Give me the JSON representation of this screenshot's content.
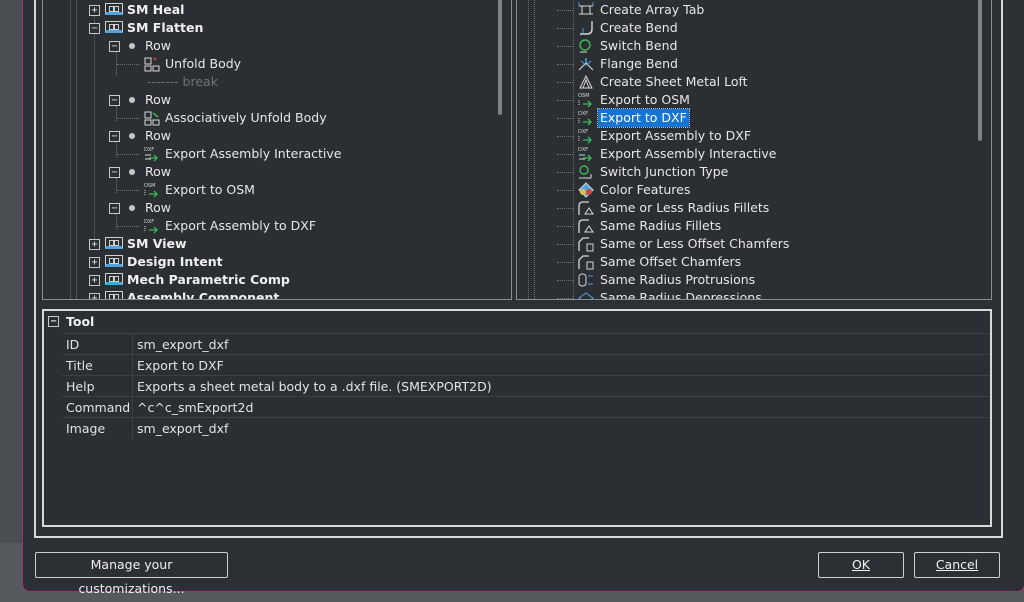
{
  "left_tree": [
    {
      "label": "SM Heal",
      "kind": "group",
      "expander": "+"
    },
    {
      "label": "SM Flatten",
      "kind": "group",
      "expander": "−"
    },
    {
      "label": "Row",
      "kind": "row",
      "expander": "−"
    },
    {
      "label": "Unfold Body",
      "kind": "tool",
      "icon": "unfold-body-icon"
    },
    {
      "label": "------- break",
      "kind": "break"
    },
    {
      "label": "Row",
      "kind": "row",
      "expander": "−"
    },
    {
      "label": "Associatively Unfold Body",
      "kind": "tool",
      "icon": "associative-unfold-icon"
    },
    {
      "label": "Row",
      "kind": "row",
      "expander": "−"
    },
    {
      "label": "Export Assembly Interactive",
      "kind": "tool",
      "icon": "export-assembly-interactive-icon"
    },
    {
      "label": "Row",
      "kind": "row",
      "expander": "−"
    },
    {
      "label": "Export to OSM",
      "kind": "tool",
      "icon": "export-osm-icon"
    },
    {
      "label": "Row",
      "kind": "row",
      "expander": "−"
    },
    {
      "label": "Export Assembly to DXF",
      "kind": "tool",
      "icon": "export-assembly-dxf-icon"
    },
    {
      "label": "SM View",
      "kind": "group",
      "expander": "+"
    },
    {
      "label": "Design Intent",
      "kind": "group",
      "expander": "+"
    },
    {
      "label": "Mech Parametric Comp",
      "kind": "group",
      "expander": "+"
    },
    {
      "label": "Assembly Component",
      "kind": "group",
      "expander": "+"
    }
  ],
  "right_list": [
    {
      "label": "Create Array Tab",
      "icon": "array-tab-icon"
    },
    {
      "label": "Create Bend",
      "icon": "create-bend-icon"
    },
    {
      "label": "Switch Bend",
      "icon": "switch-bend-icon"
    },
    {
      "label": "Flange Bend",
      "icon": "flange-bend-icon"
    },
    {
      "label": "Create Sheet Metal Loft",
      "icon": "sheet-metal-loft-icon"
    },
    {
      "label": "Export to OSM",
      "icon": "export-osm-icon"
    },
    {
      "label": "Export to DXF",
      "icon": "export-dxf-icon",
      "selected": true
    },
    {
      "label": "Export Assembly to DXF",
      "icon": "export-assembly-dxf-icon"
    },
    {
      "label": "Export Assembly Interactive",
      "icon": "export-assembly-interactive-icon"
    },
    {
      "label": "Switch Junction Type",
      "icon": "switch-junction-icon"
    },
    {
      "label": "Color Features",
      "icon": "color-features-icon"
    },
    {
      "label": "Same or Less Radius Fillets",
      "icon": "less-radius-fillets-icon"
    },
    {
      "label": "Same Radius Fillets",
      "icon": "same-radius-fillets-icon"
    },
    {
      "label": "Same or Less Offset Chamfers",
      "icon": "less-offset-chamfers-icon"
    },
    {
      "label": "Same Offset Chamfers",
      "icon": "same-offset-chamfers-icon"
    },
    {
      "label": "Same Radius Protrusions",
      "icon": "same-radius-protrusions-icon"
    },
    {
      "label": "Same Radius Depressions",
      "icon": "same-radius-depressions-icon"
    }
  ],
  "icon_captions": {
    "dxf": "DXF",
    "osm": "OSM"
  },
  "properties": {
    "section_label": "Tool",
    "section_expander": "−",
    "rows": [
      {
        "key": "ID",
        "value": "sm_export_dxf"
      },
      {
        "key": "Title",
        "value": "Export to DXF"
      },
      {
        "key": "Help",
        "value": "Exports a sheet metal body to a .dxf file. (SMEXPORT2D)"
      },
      {
        "key": "Command",
        "value": "^c^c_smExport2d"
      },
      {
        "key": "Image",
        "value": "sm_export_dxf"
      }
    ]
  },
  "buttons": {
    "manage": "Manage your customizations...",
    "ok": "OK",
    "cancel": "Cancel"
  },
  "colors": {
    "selection": "#1674d2",
    "dialog_border": "#a0326e",
    "icon_blue": "#4fa3e0",
    "icon_green": "#3cba54"
  }
}
